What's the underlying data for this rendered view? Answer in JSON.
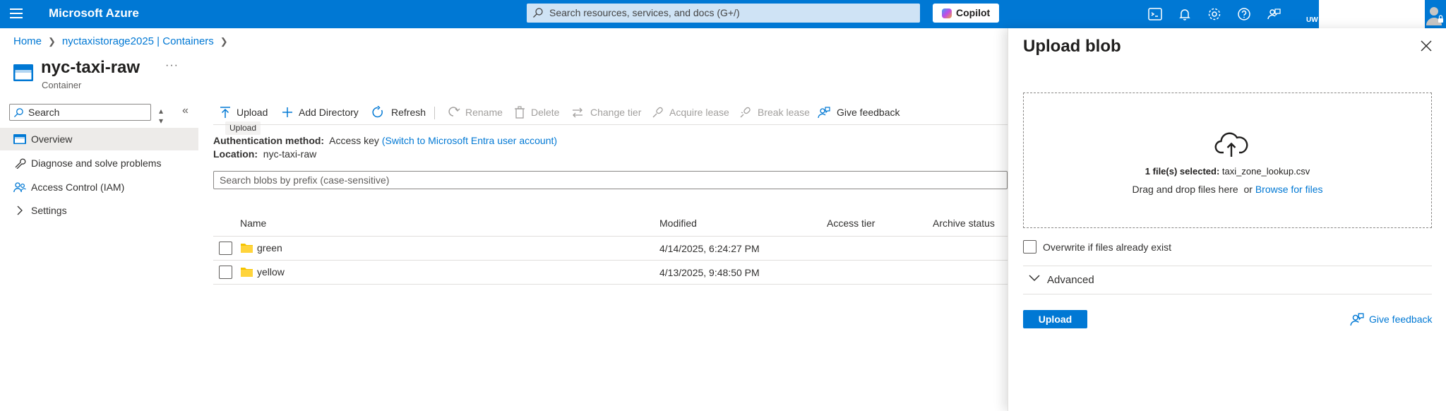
{
  "topbar": {
    "brand": "Microsoft Azure",
    "search_placeholder": "Search resources, services, and docs (G+/)",
    "copilot_label": "Copilot",
    "user_initials": "UW",
    "icons": [
      "cloud-shell-icon",
      "bell-icon",
      "gear-icon",
      "help-icon",
      "feedback-icon"
    ]
  },
  "breadcrumb": {
    "home": "Home",
    "storage": "nyctaxistorage2025 | Containers"
  },
  "resource": {
    "title": "nyc-taxi-raw",
    "more": "···",
    "subtitle": "Container"
  },
  "leftnav": {
    "search_placeholder": "Search",
    "items": [
      {
        "label": "Overview",
        "icon": "overview-icon",
        "active": true
      },
      {
        "label": "Diagnose and solve problems",
        "icon": "wrench-icon"
      },
      {
        "label": "Access Control (IAM)",
        "icon": "people-icon"
      },
      {
        "label": "Settings",
        "icon": "chevron-right-icon"
      }
    ]
  },
  "toolbar": {
    "upload": "Upload",
    "add_directory": "Add Directory",
    "refresh": "Refresh",
    "rename": "Rename",
    "delete": "Delete",
    "change_tier": "Change tier",
    "acquire_lease": "Acquire lease",
    "break_lease": "Break lease",
    "give_feedback": "Give feedback",
    "tooltip": "Upload"
  },
  "info": {
    "auth_label": "Authentication method:",
    "auth_value": "Access key",
    "auth_link": "(Switch to Microsoft Entra user account)",
    "location_label": "Location:",
    "location_value": "nyc-taxi-raw"
  },
  "blob_search_placeholder": "Search blobs by prefix (case-sensitive)",
  "table": {
    "columns": [
      "Name",
      "Modified",
      "Access tier",
      "Archive status"
    ],
    "rows": [
      {
        "name": "green",
        "modified": "4/14/2025, 6:24:27 PM"
      },
      {
        "name": "yellow",
        "modified": "4/13/2025, 9:48:50 PM"
      }
    ]
  },
  "upload_panel": {
    "title": "Upload blob",
    "selected_prefix": "1 file(s) selected:",
    "selected_file": "taxi_zone_lookup.csv",
    "drag_text": "Drag and drop files here  or ",
    "browse_link": "Browse for files",
    "overwrite_label": "Overwrite if files already exist",
    "advanced_label": "Advanced",
    "upload_button": "Upload",
    "feedback_link": "Give feedback"
  },
  "colors": {
    "azure_blue": "#0078d4",
    "folder_yellow": "#f5c400",
    "nav_active": "#edebe9"
  }
}
